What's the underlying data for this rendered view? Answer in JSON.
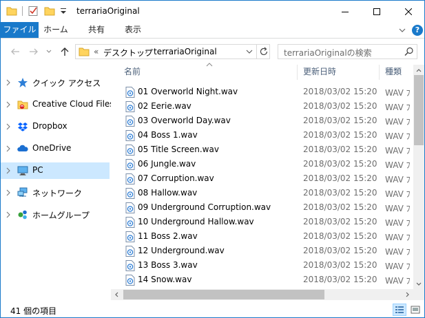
{
  "window": {
    "title": "terrariaOriginal",
    "controls": [
      "minimize",
      "maximize",
      "close"
    ]
  },
  "ribbon": {
    "tabs": [
      "ファイル",
      "ホーム",
      "共有",
      "表示"
    ],
    "help": "?"
  },
  "address": {
    "overflow": "«",
    "crumbs": [
      "デスクトップ",
      "terrariaOriginal"
    ],
    "separator": "›"
  },
  "search": {
    "placeholder": "terrariaOriginalの検索"
  },
  "sidebar": {
    "items": [
      {
        "label": "クイック アクセス",
        "icon": "star-icon",
        "selected": false
      },
      {
        "label": "Creative Cloud Files",
        "icon": "creative-cloud-folder-icon",
        "selected": false
      },
      {
        "label": "Dropbox",
        "icon": "dropbox-icon",
        "selected": false
      },
      {
        "label": "OneDrive",
        "icon": "onedrive-cloud-icon",
        "selected": false
      },
      {
        "label": "PC",
        "icon": "pc-monitor-icon",
        "selected": true
      },
      {
        "label": "ネットワーク",
        "icon": "network-icon",
        "selected": false
      },
      {
        "label": "ホームグループ",
        "icon": "homegroup-icon",
        "selected": false
      }
    ]
  },
  "columns": {
    "name": "名前",
    "date": "更新日時",
    "type": "種類"
  },
  "files": [
    {
      "name": "01 Overworld Night.wav",
      "date": "2018/03/02 15:20",
      "type": "WAV ﾌ"
    },
    {
      "name": "02 Eerie.wav",
      "date": "2018/03/02 15:20",
      "type": "WAV ﾌ"
    },
    {
      "name": "03 Overworld Day.wav",
      "date": "2018/03/02 15:20",
      "type": "WAV ﾌ"
    },
    {
      "name": "04 Boss 1.wav",
      "date": "2018/03/02 15:20",
      "type": "WAV ﾌ"
    },
    {
      "name": "05 Title Screen.wav",
      "date": "2018/03/02 15:20",
      "type": "WAV ﾌ"
    },
    {
      "name": "06 Jungle.wav",
      "date": "2018/03/02 15:20",
      "type": "WAV ﾌ"
    },
    {
      "name": "07 Corruption.wav",
      "date": "2018/03/02 15:20",
      "type": "WAV ﾌ"
    },
    {
      "name": "08 Hallow.wav",
      "date": "2018/03/02 15:20",
      "type": "WAV ﾌ"
    },
    {
      "name": "09 Underground Corruption.wav",
      "date": "2018/03/02 15:20",
      "type": "WAV ﾌ"
    },
    {
      "name": "10 Underground Hallow.wav",
      "date": "2018/03/02 15:20",
      "type": "WAV ﾌ"
    },
    {
      "name": "11 Boss 2.wav",
      "date": "2018/03/02 15:20",
      "type": "WAV ﾌ"
    },
    {
      "name": "12 Underground.wav",
      "date": "2018/03/02 15:20",
      "type": "WAV ﾌ"
    },
    {
      "name": "13 Boss 3.wav",
      "date": "2018/03/02 15:20",
      "type": "WAV ﾌ"
    },
    {
      "name": "14 Snow.wav",
      "date": "2018/03/02 15:20",
      "type": "WAV ﾌ"
    }
  ],
  "status": {
    "item_count": "41 個の項目"
  },
  "colors": {
    "accent": "#1979ca",
    "selection": "#cce8ff",
    "folder": "#ffd45e"
  }
}
